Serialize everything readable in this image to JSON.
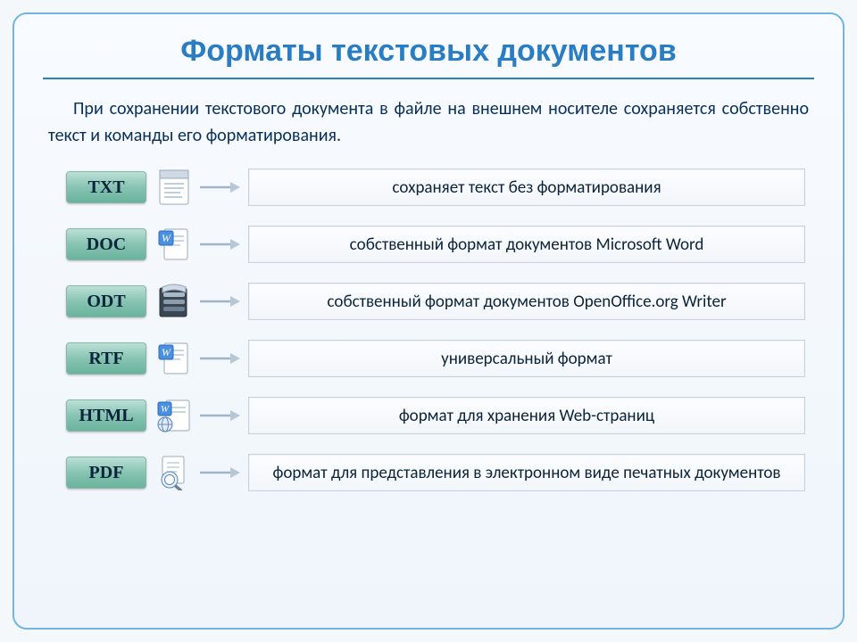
{
  "title": "Форматы текстовых документов",
  "intro": "При сохранении текстового документа в файле на внешнем носителе сохраняется собственно текст и команды его форматирования.",
  "formats": [
    {
      "label": "TXT",
      "icon": "txt",
      "description": "сохраняет текст без форматирования"
    },
    {
      "label": "DOC",
      "icon": "doc",
      "description": "собственный формат документов Microsoft Word"
    },
    {
      "label": "ODT",
      "icon": "odt",
      "description": "собственный формат документов OpenOffice.org Writer"
    },
    {
      "label": "RTF",
      "icon": "rtf",
      "description": "универсальный формат"
    },
    {
      "label": "HTML",
      "icon": "html",
      "description": "формат для хранения Web-страниц"
    },
    {
      "label": "PDF",
      "icon": "pdf",
      "description": "формат для представления в электронном виде печатных документов"
    }
  ]
}
